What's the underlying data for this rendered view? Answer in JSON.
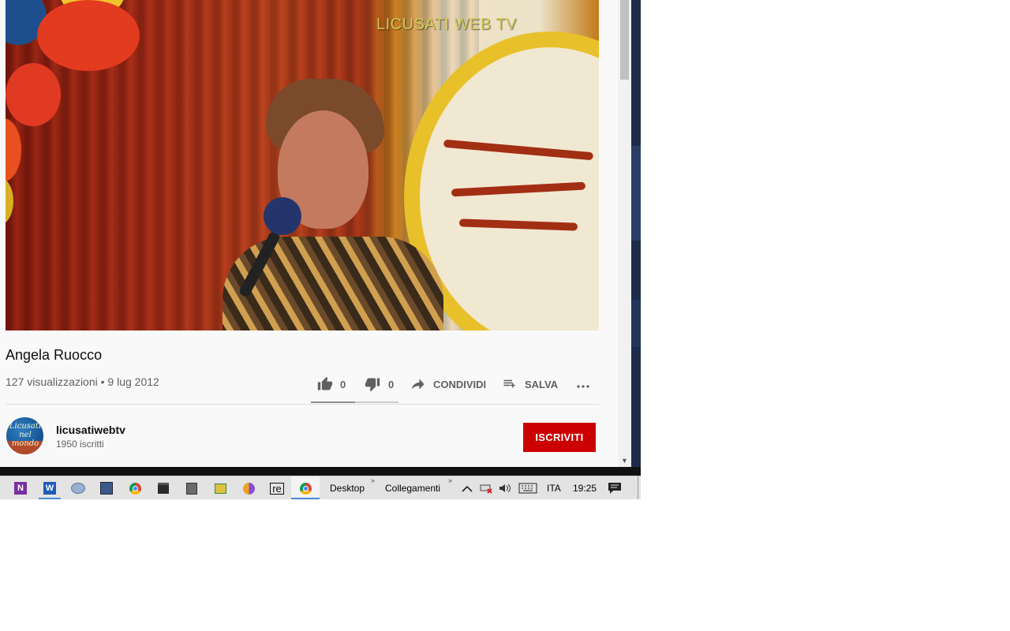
{
  "video": {
    "watermark": "LICUSATI WEB TV",
    "title": "Angela Ruocco",
    "views": "127 visualizzazioni",
    "separator": "•",
    "date": "9 lug 2012"
  },
  "actions": {
    "like_count": "0",
    "dislike_count": "0",
    "share_label": "CONDIVIDI",
    "save_label": "SALVA",
    "like_ratio": 0.5
  },
  "channel": {
    "name": "licusatiwebtv",
    "subscribers": "1950 iscritti",
    "avatar_text": "Licusati nel mondo",
    "subscribe_label": "ISCRIVITI"
  },
  "taskbar": {
    "apps": [
      "onenote-icon",
      "word-icon",
      "network-drive-icon",
      "devices-icon",
      "chrome-icon",
      "store-icon",
      "files-icon",
      "photos-icon",
      "app-circle-icon",
      "re-app-icon",
      "chrome-active-icon"
    ],
    "re_label": "re",
    "desktop_label": "Desktop",
    "links_label": "Collegamenti",
    "language": "ITA",
    "time": "19:25"
  },
  "colors": {
    "subscribe_red": "#cc0000",
    "text_primary": "#0f0f0f",
    "text_secondary": "#606060",
    "page_bg": "#f9f9f9"
  }
}
